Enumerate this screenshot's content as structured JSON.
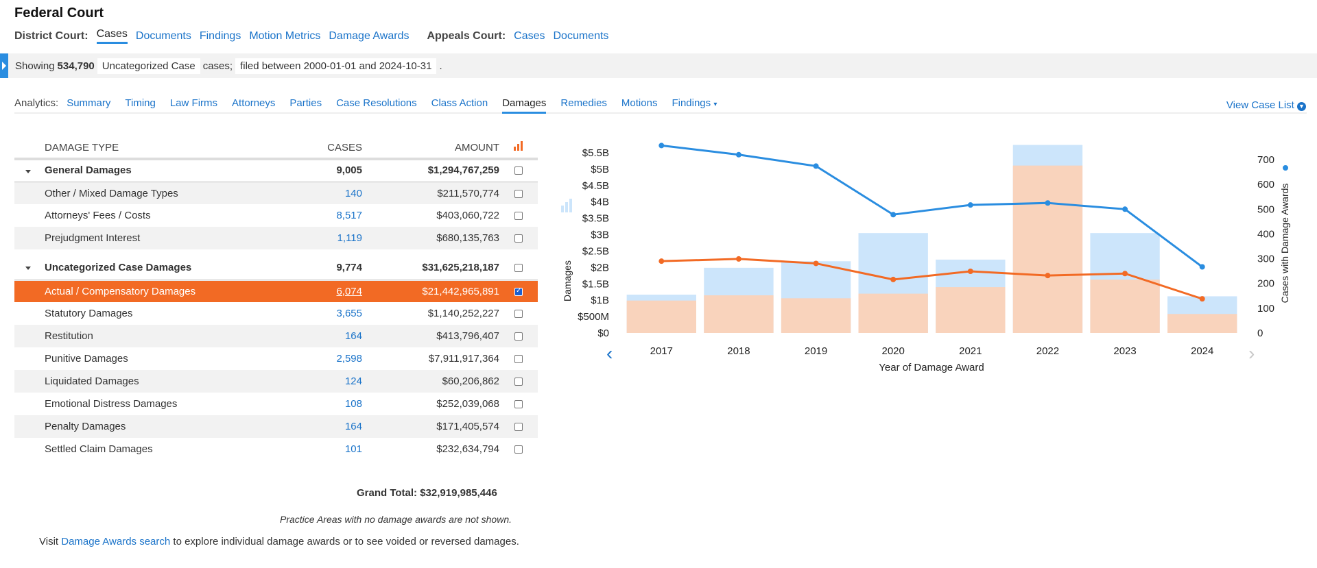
{
  "title": "Federal Court",
  "court_nav": {
    "district_label": "District Court:",
    "district_items": [
      "Cases",
      "Documents",
      "Findings",
      "Motion Metrics",
      "Damage Awards"
    ],
    "district_selected": "Cases",
    "appeals_label": "Appeals Court:",
    "appeals_items": [
      "Cases",
      "Documents"
    ]
  },
  "filter": {
    "prefix": "Showing",
    "count": "534,790",
    "case_type": "Uncategorized Case",
    "mid": "cases;",
    "date_range": "filed between 2000-01-01 and 2024-10-31",
    "suffix": "."
  },
  "analytics": {
    "label": "Analytics:",
    "tabs": [
      "Summary",
      "Timing",
      "Law Firms",
      "Attorneys",
      "Parties",
      "Case Resolutions",
      "Class Action",
      "Damages",
      "Remedies",
      "Motions",
      "Findings"
    ],
    "selected": "Damages",
    "view_case_list": "View Case List"
  },
  "table": {
    "headers": {
      "type": "DAMAGE TYPE",
      "cases": "CASES",
      "amount": "AMOUNT"
    },
    "groups": [
      {
        "name": "General Damages",
        "cases": "9,005",
        "amount": "$1,294,767,259",
        "rows": [
          {
            "name": "Other / Mixed Damage Types",
            "cases": "140",
            "amount": "$211,570,774",
            "checked": false
          },
          {
            "name": "Attorneys' Fees / Costs",
            "cases": "8,517",
            "amount": "$403,060,722",
            "checked": false
          },
          {
            "name": "Prejudgment Interest",
            "cases": "1,119",
            "amount": "$680,135,763",
            "checked": false
          }
        ]
      },
      {
        "name": "Uncategorized Case Damages",
        "cases": "9,774",
        "amount": "$31,625,218,187",
        "rows": [
          {
            "name": "Actual / Compensatory Damages",
            "cases": "6,074",
            "amount": "$21,442,965,891",
            "checked": true
          },
          {
            "name": "Statutory Damages",
            "cases": "3,655",
            "amount": "$1,140,252,227",
            "checked": false
          },
          {
            "name": "Restitution",
            "cases": "164",
            "amount": "$413,796,407",
            "checked": false
          },
          {
            "name": "Punitive Damages",
            "cases": "2,598",
            "amount": "$7,911,917,364",
            "checked": false
          },
          {
            "name": "Liquidated Damages",
            "cases": "124",
            "amount": "$60,206,862",
            "checked": false
          },
          {
            "name": "Emotional Distress Damages",
            "cases": "108",
            "amount": "$252,039,068",
            "checked": false
          },
          {
            "name": "Penalty Damages",
            "cases": "164",
            "amount": "$171,405,574",
            "checked": false
          },
          {
            "name": "Settled Claim Damages",
            "cases": "101",
            "amount": "$232,634,794",
            "checked": false
          }
        ]
      }
    ],
    "grand_total": "Grand Total: $32,919,985,446",
    "note": "Practice Areas with no damage awards are not shown.",
    "visit_prefix": "Visit",
    "visit_link": "Damage Awards search",
    "visit_suffix": "to explore individual damage awards or to see voided or reversed damages."
  },
  "colors": {
    "accent": "#2a8de0",
    "highlight": "#f26a24",
    "bar_total": "#cce5fb",
    "bar_selected": "#f9d3bc",
    "line_total": "#2a8de0",
    "line_selected": "#f26a24"
  },
  "chart_data": {
    "type": "bar+line",
    "categories": [
      "2017",
      "2018",
      "2019",
      "2020",
      "2021",
      "2022",
      "2023",
      "2024"
    ],
    "xlabel": "Year of Damage Award",
    "ylabel": "Damages",
    "y2label": "Cases with Damage Awards",
    "ylim": [
      0,
      5500000000
    ],
    "y2lim": [
      0,
      700
    ],
    "yticks": [
      "$0",
      "$500M",
      "$1B",
      "$1.5B",
      "$2B",
      "$2.5B",
      "$3B",
      "$3.5B",
      "$4B",
      "$4.5B",
      "$5B",
      "$5.5B"
    ],
    "y2ticks": [
      "0",
      "100",
      "200",
      "300",
      "400",
      "500",
      "600",
      "700"
    ],
    "bars_total": [
      1170000000,
      1990000000,
      2190000000,
      3050000000,
      2240000000,
      5740000000,
      3050000000,
      1120000000
    ],
    "bars_selected": [
      990000000,
      1150000000,
      1060000000,
      1200000000,
      1400000000,
      5110000000,
      1630000000,
      580000000
    ],
    "line_total": [
      757,
      720,
      674,
      478,
      517,
      525,
      500,
      267
    ],
    "line_selected": [
      290,
      299,
      281,
      216,
      249,
      232,
      240,
      138
    ]
  }
}
